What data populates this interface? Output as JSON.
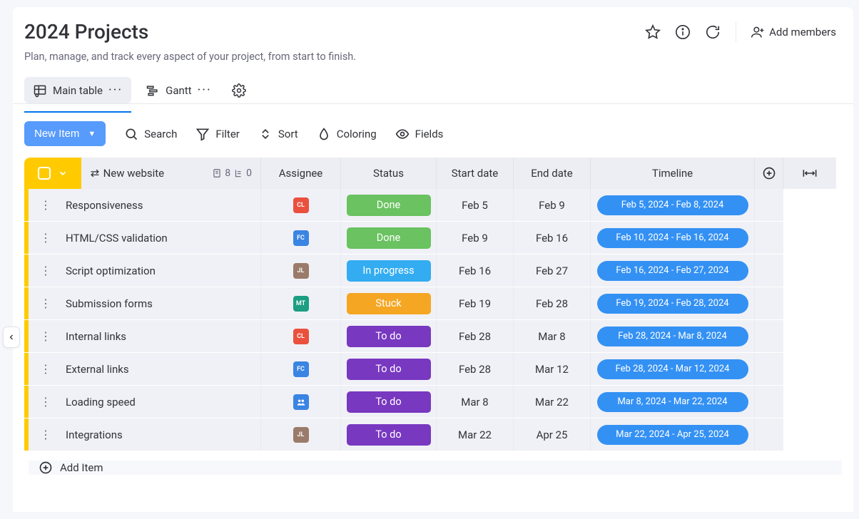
{
  "header": {
    "title": "2024 Projects",
    "subtitle": "Plan, manage, and track every aspect of your project, from start to finish.",
    "add_members": "Add members"
  },
  "views": {
    "main_table": "Main table",
    "gantt": "Gantt"
  },
  "toolbar": {
    "new_item": "New Item",
    "search": "Search",
    "filter": "Filter",
    "sort": "Sort",
    "coloring": "Coloring",
    "fields": "Fields"
  },
  "columns": {
    "group": "New website",
    "count": "8",
    "subcount": "0",
    "assignee": "Assignee",
    "status": "Status",
    "start": "Start date",
    "end": "End date",
    "timeline": "Timeline"
  },
  "status_colors": {
    "done": "#6ac260",
    "in_progress": "#33acf1",
    "stuck": "#f5a623",
    "todo": "#7838c0"
  },
  "avatar_colors": {
    "CL": "#e9513e",
    "FC": "#3a84e3",
    "JL": "#9a7b6a",
    "MT": "#1b9e82",
    "TEAM": "#3a84e3"
  },
  "rows": [
    {
      "name": "Responsiveness",
      "assignee": "CL",
      "assignee_key": "CL",
      "status": "Done",
      "status_key": "done",
      "start": "Feb 5",
      "end": "Feb 9",
      "timeline": "Feb 5, 2024 - Feb 8, 2024"
    },
    {
      "name": "HTML/CSS validation",
      "assignee": "FC",
      "assignee_key": "FC",
      "status": "Done",
      "status_key": "done",
      "start": "Feb 9",
      "end": "Feb 16",
      "timeline": "Feb 10, 2024 - Feb 16, 2024"
    },
    {
      "name": "Script optimization",
      "assignee": "JL",
      "assignee_key": "JL",
      "status": "In progress",
      "status_key": "in_progress",
      "start": "Feb 16",
      "end": "Feb 27",
      "timeline": "Feb 16, 2024 - Feb 27, 2024"
    },
    {
      "name": "Submission forms",
      "assignee": "MT",
      "assignee_key": "MT",
      "status": "Stuck",
      "status_key": "stuck",
      "start": "Feb 19",
      "end": "Feb 28",
      "timeline": "Feb 19, 2024 - Feb 28, 2024"
    },
    {
      "name": "Internal links",
      "assignee": "CL",
      "assignee_key": "CL",
      "status": "To do",
      "status_key": "todo",
      "start": "Feb 28",
      "end": "Mar 8",
      "timeline": "Feb 28, 2024 - Mar 8, 2024"
    },
    {
      "name": "External links",
      "assignee": "FC",
      "assignee_key": "FC",
      "status": "To do",
      "status_key": "todo",
      "start": "Feb 28",
      "end": "Mar 12",
      "timeline": "Feb 28, 2024 - Mar 12, 2024"
    },
    {
      "name": "Loading speed",
      "assignee": "TEAM",
      "assignee_key": "TEAM",
      "status": "To do",
      "status_key": "todo",
      "start": "Mar 8",
      "end": "Mar 22",
      "timeline": "Mar 8, 2024 - Mar 22, 2024"
    },
    {
      "name": "Integrations",
      "assignee": "JL",
      "assignee_key": "JL",
      "status": "To do",
      "status_key": "todo",
      "start": "Mar 22",
      "end": "Apr 25",
      "timeline": "Mar 22, 2024 - Apr 25, 2024"
    }
  ],
  "add_item": "Add Item"
}
